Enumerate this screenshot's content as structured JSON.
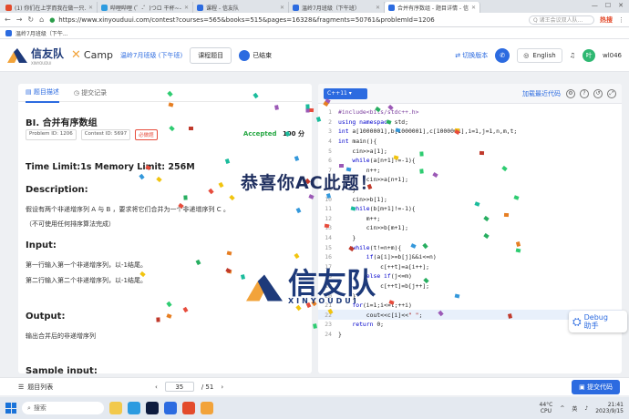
{
  "browser": {
    "tabs": [
      {
        "label": "(1) 你们在上学而我在做一只...",
        "color": "#e34b2c",
        "active": false
      },
      {
        "label": "哔哩哔哩 (゜-゜)つロ 干杯~-b...",
        "color": "#2c9be0",
        "active": false
      },
      {
        "label": "课程 - 信友队",
        "color": "#2c6be0",
        "active": false
      },
      {
        "label": "温岭7月班级（下午班）",
        "color": "#2c6be0",
        "active": false
      },
      {
        "label": "合并有序数组 - 题目详情 - 信友...",
        "color": "#2c6be0",
        "active": true
      }
    ],
    "url": "https://www.xinyouduui.com/contest?courses=565&books=515&pages=16328&fragments=50761&problemId=1206",
    "search_placeholder": "Q 诸王会议双人队...",
    "hot_label": "热搜",
    "bookmark": "温岭7月班级（下午..."
  },
  "header": {
    "logo_text": "信友队",
    "logo_sub": "XINYOUDUI",
    "xcamp": "Camp",
    "class_name": "温岭7月班级 (下午班)",
    "course_btn": "课程题目",
    "status": "已结束",
    "switch_version": "切换版本",
    "lang": "English",
    "user": "wl046",
    "avatar_char": "叶"
  },
  "problem": {
    "tab_desc": "题目描述",
    "tab_submissions": "提交记录",
    "title": "BI. 合并有序数组",
    "problem_id": "Problem ID: 1206",
    "contest_id": "Contest ID: 5697",
    "required": "必做题",
    "accepted": "Accepted",
    "score": "100 分",
    "limits": "Time Limit:1s Memory Limit: 256M",
    "desc_h": "Description:",
    "desc_1": "假设有两个非递增序列 A 与 B ，要求将它们合并为一个非递增序列 C 。",
    "desc_2": "（不可使用任何排序算法完成）",
    "input_h": "Input:",
    "input_1": "第一行输入第一个非递增序列，以-1结尾。",
    "input_2": "第二行输入第二个非递增序列，以-1结尾。",
    "output_h": "Output:",
    "output_1": "输出合并后的非递增序列",
    "sample_h": "Sample input:"
  },
  "editor": {
    "language": "C++11",
    "load_last": "加载最近代码",
    "code_lines": [
      "#include<bits/stdc++.h>",
      "using namespace std;",
      "int a[1000001],b[1000001],c[1000001],i=1,j=1,n,m,t;",
      "int main(){",
      "    cin>>a[1];",
      "    while(a[n+1]!=-1){",
      "        n++;",
      "        cin>>a[n+1];",
      "    }",
      "    cin>>b[1];",
      "    while(b[m+1]!=-1){",
      "        m++;",
      "        cin>>b[m+1];",
      "    }",
      "    while(t!=n+m){",
      "        if(a[i]>=b[j]&&i<=n)",
      "            c[++t]=a[i++];",
      "        else if(j<=m)",
      "            c[++t]=b[j++];",
      "    }",
      "    for(i=1;i<=t;++i)",
      "        cout<<c[i]<<\" \";",
      "    return 0;",
      "}"
    ]
  },
  "bottom": {
    "problem_list": "题目列表",
    "page": "35",
    "total": "/ 51",
    "submit": "提交代码"
  },
  "overlay": {
    "congrats": "恭喜你AC此题！",
    "debug": "Debug",
    "debug_sub": "助手"
  },
  "taskbar": {
    "search": "搜索",
    "temp": "44°C",
    "temp_sub": "CPU",
    "ime": "英",
    "time": "21:41",
    "date": "2023/9/15"
  }
}
